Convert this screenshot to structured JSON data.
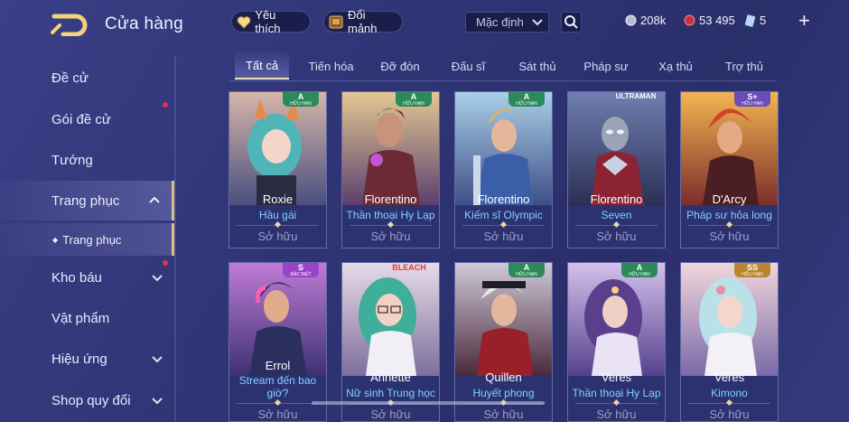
{
  "header": {
    "title": "Cửa hàng",
    "favorite_label": "Yêu thích",
    "exchange_label": "Đổi mảnh",
    "sort_value": "Mặc định",
    "currency_gold": "208k",
    "currency_gem": "53 495",
    "currency_voucher": "5"
  },
  "sidebar": {
    "items": [
      {
        "label": "Đề cử"
      },
      {
        "label": "Gói đề cử"
      },
      {
        "label": "Tướng"
      },
      {
        "label": "Trang phục"
      },
      {
        "label": "Trang phục"
      },
      {
        "label": "Kho báu"
      },
      {
        "label": "Vật phẩm"
      },
      {
        "label": "Hiệu ứng"
      },
      {
        "label": "Shop quy đổi"
      }
    ]
  },
  "tabs": [
    {
      "label": "Tất cả"
    },
    {
      "label": "Tiến hóa"
    },
    {
      "label": "Đỡ đòn"
    },
    {
      "label": "Đấu sĩ"
    },
    {
      "label": "Sát thủ"
    },
    {
      "label": "Pháp sư"
    },
    {
      "label": "Xạ thủ"
    },
    {
      "label": "Trợ thủ"
    }
  ],
  "cards": [
    {
      "hero": "Roxie",
      "skin": "Hầu gái",
      "owned": "Sở hữu",
      "rank": "A",
      "rank_sub": "HỮU HẠN"
    },
    {
      "hero": "Florentino",
      "skin": "Thần thoại Hy Lạp",
      "owned": "Sở hữu",
      "rank": "A",
      "rank_sub": "HỮU HẠN"
    },
    {
      "hero": "Florentino",
      "skin": "Kiếm sĩ Olympic",
      "owned": "Sở hữu",
      "rank": "A",
      "rank_sub": "HỮU HẠN"
    },
    {
      "hero": "Florentino",
      "skin": "Seven",
      "owned": "Sở hữu",
      "rank": "ULTRAMAN",
      "rank_sub": ""
    },
    {
      "hero": "D'Arcy",
      "skin": "Pháp sư hỏa long",
      "owned": "Sở hữu",
      "rank": "S+",
      "rank_sub": "HỮU HẠN"
    },
    {
      "hero": "Errol",
      "skin": "Stream đến bao giờ?",
      "owned": "Sở hữu",
      "rank": "S",
      "rank_sub": "ĐẶC BIỆT"
    },
    {
      "hero": "Annette",
      "skin": "Nữ sinh Trung học",
      "owned": "Sở hữu",
      "rank": "BLEACH",
      "rank_sub": ""
    },
    {
      "hero": "Quillen",
      "skin": "Huyết phong",
      "owned": "Sở hữu",
      "rank": "A",
      "rank_sub": "HỮU HẠN"
    },
    {
      "hero": "Veres",
      "skin": "Thần thoại Hy Lạp",
      "owned": "Sở hữu",
      "rank": "A",
      "rank_sub": "HỮU HẠN"
    },
    {
      "hero": "Veres",
      "skin": "Kimono",
      "owned": "Sở hữu",
      "rank": "SS",
      "rank_sub": "HỮU HẠN"
    }
  ],
  "colors": {
    "accent_gold": "#d9c28a",
    "skin_name": "#7ed2ff",
    "notification": "#e3344b"
  }
}
